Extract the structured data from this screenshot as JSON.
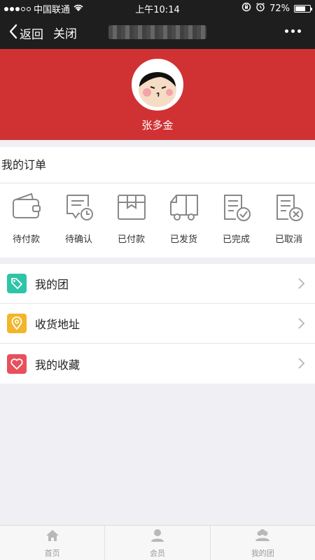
{
  "status_bar": {
    "carrier": "中国联通",
    "time": "上午10:14",
    "battery": "72%",
    "battery_level": 0.72
  },
  "nav": {
    "back_label": "返回",
    "close_label": "关闭",
    "more_icon": "more-dots-icon"
  },
  "profile": {
    "username": "张多金",
    "background_color": "#d03234"
  },
  "orders": {
    "title": "我的订单",
    "items": [
      {
        "label": "待付款",
        "icon": "wallet-icon"
      },
      {
        "label": "待确认",
        "icon": "confirm-clock-icon"
      },
      {
        "label": "已付款",
        "icon": "box-icon"
      },
      {
        "label": "已发货",
        "icon": "truck-icon"
      },
      {
        "label": "已完成",
        "icon": "doc-check-icon"
      },
      {
        "label": "已取消",
        "icon": "doc-cancel-icon"
      }
    ]
  },
  "menu": [
    {
      "label": "我的团",
      "icon": "tag-icon",
      "color": "#2ec4a8"
    },
    {
      "label": "收货地址",
      "icon": "location-icon",
      "color": "#f2b62b"
    },
    {
      "label": "我的收藏",
      "icon": "heart-icon",
      "color": "#e8505b"
    }
  ],
  "tabbar": [
    {
      "label": "首页",
      "icon": "home-icon"
    },
    {
      "label": "会员",
      "icon": "member-icon"
    },
    {
      "label": "我的团",
      "icon": "group-icon"
    }
  ]
}
